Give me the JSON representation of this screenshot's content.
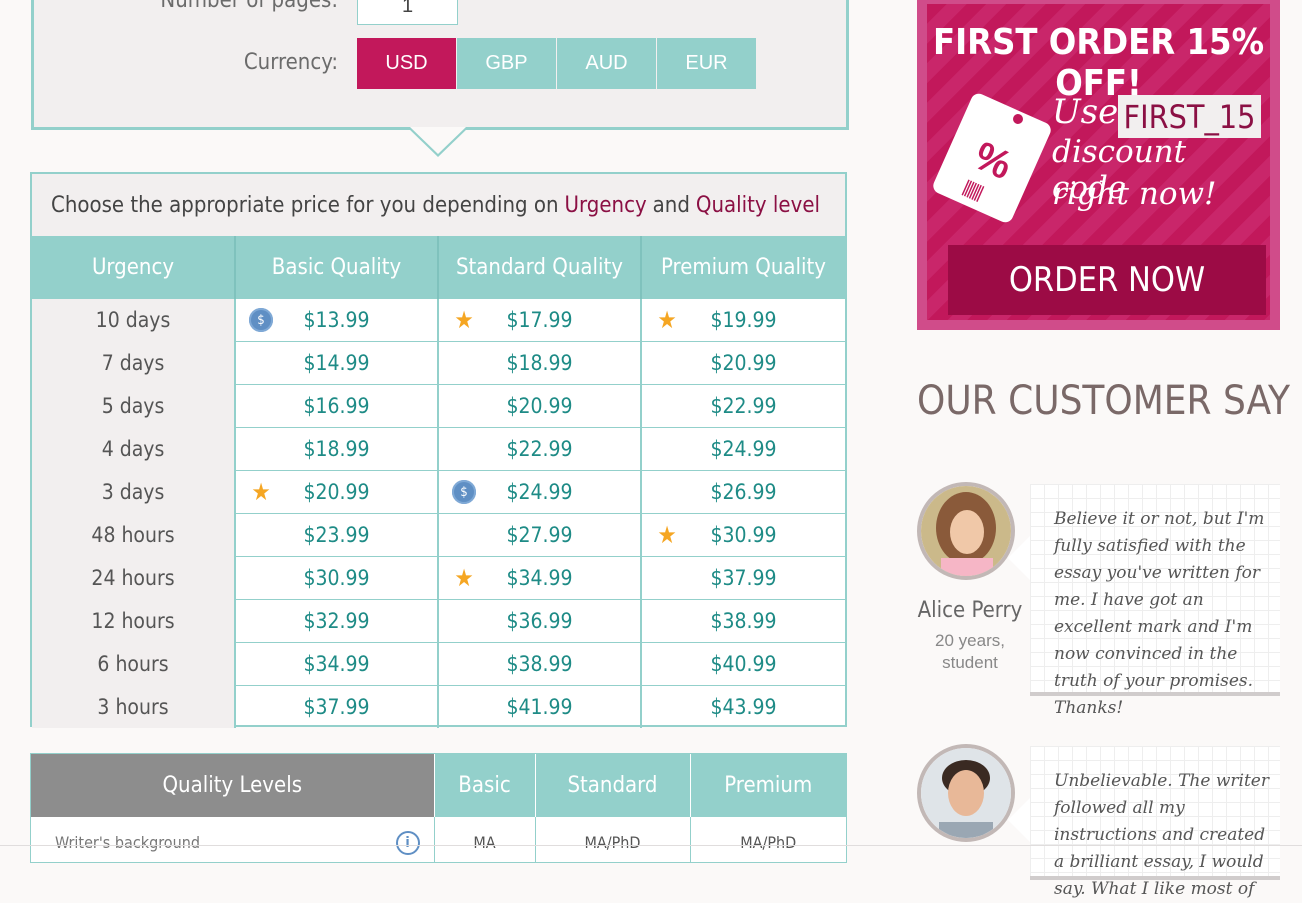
{
  "calculator": {
    "pages_label": "Number of pages:",
    "pages_value": "1",
    "currency_label": "Currency:",
    "currencies": [
      "USD",
      "GBP",
      "AUD",
      "EUR"
    ],
    "selected_currency": "USD"
  },
  "price_table": {
    "heading_prefix": "Choose the appropriate price for you depending on",
    "heading_urgency": "Urgency",
    "heading_and": "and",
    "heading_quality": "Quality level",
    "columns": [
      "Urgency",
      "Basic Quality",
      "Standard Quality",
      "Premium Quality"
    ],
    "rows": [
      {
        "urgency": "10 days",
        "prices": [
          "$13.99",
          "$17.99",
          "$19.99"
        ],
        "marks": [
          "coin-icon",
          "star-icon",
          "star-icon"
        ]
      },
      {
        "urgency": "7 days",
        "prices": [
          "$14.99",
          "$18.99",
          "$20.99"
        ],
        "marks": [
          "",
          "",
          ""
        ]
      },
      {
        "urgency": "5 days",
        "prices": [
          "$16.99",
          "$20.99",
          "$22.99"
        ],
        "marks": [
          "",
          "",
          ""
        ]
      },
      {
        "urgency": "4 days",
        "prices": [
          "$18.99",
          "$22.99",
          "$24.99"
        ],
        "marks": [
          "",
          "",
          ""
        ]
      },
      {
        "urgency": "3 days",
        "prices": [
          "$20.99",
          "$24.99",
          "$26.99"
        ],
        "marks": [
          "star-icon",
          "coin-icon",
          ""
        ]
      },
      {
        "urgency": "48 hours",
        "prices": [
          "$23.99",
          "$27.99",
          "$30.99"
        ],
        "marks": [
          "",
          "",
          "star-icon"
        ]
      },
      {
        "urgency": "24 hours",
        "prices": [
          "$30.99",
          "$34.99",
          "$37.99"
        ],
        "marks": [
          "",
          "star-icon",
          ""
        ]
      },
      {
        "urgency": "12 hours",
        "prices": [
          "$32.99",
          "$36.99",
          "$38.99"
        ],
        "marks": [
          "",
          "",
          ""
        ]
      },
      {
        "urgency": "6 hours",
        "prices": [
          "$34.99",
          "$38.99",
          "$40.99"
        ],
        "marks": [
          "",
          "",
          ""
        ]
      },
      {
        "urgency": "3 hours",
        "prices": [
          "$37.99",
          "$41.99",
          "$43.99"
        ],
        "marks": [
          "",
          "",
          ""
        ]
      }
    ]
  },
  "quality_table": {
    "columns": [
      "Quality Levels",
      "Basic",
      "Standard",
      "Premium"
    ],
    "row": {
      "label": "Writer's background",
      "values": [
        "MA",
        "MA/PhD",
        "MA/PhD"
      ]
    }
  },
  "promo": {
    "title": "FIRST ORDER 15% OFF!",
    "use": "Use",
    "code": "FIRST_15",
    "line2": "discount code",
    "line3": "right now!",
    "tag_symbol": "%",
    "button": "ORDER NOW"
  },
  "testimonials": {
    "title": "OUR CUSTOMER SAY",
    "items": [
      {
        "name": "Alice Perry",
        "role": "20 years, student",
        "text": "Believe it or not, but I'm fully satisfied with the essay you've written for me. I have got an excellent mark and I'm now convinced in the truth of your promises. Thanks!"
      },
      {
        "name": "",
        "role": "",
        "text": "Unbelievable. The writer followed all my instructions and created a brilliant essay, I would say. What I like most of"
      }
    ]
  },
  "colors": {
    "teal": "#93d0cb",
    "magenta": "#c2185b",
    "dark_magenta": "#9c0b45",
    "price_text": "#1e8b86"
  }
}
